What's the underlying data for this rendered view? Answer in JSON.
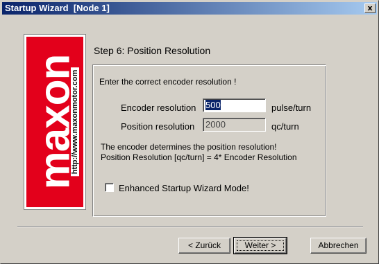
{
  "window": {
    "title": "Startup Wizard  [Node 1]",
    "close_label": "x"
  },
  "logo": {
    "brand": "maxon",
    "url": "http://www.maxonmotor.com"
  },
  "step": {
    "title": "Step 6: Position Resolution"
  },
  "group": {
    "instruction": "Enter the correct encoder resolution !",
    "encoder_label": "Encoder resolution",
    "encoder_value": "500",
    "encoder_unit": "pulse/turn",
    "position_label": "Position resolution",
    "position_value": "2000",
    "position_unit": "qc/turn",
    "note_line1": "The encoder determines the position resolution!",
    "note_line2": "Position Resolution [qc/turn] = 4* Encoder Resolution",
    "checkbox_label": "Enhanced Startup Wizard Mode!",
    "checkbox_checked": false
  },
  "buttons": {
    "back": "< Zurück",
    "next": "Weiter >",
    "cancel": "Abbrechen"
  },
  "colors": {
    "title_gradient_start": "#0a246a",
    "title_gradient_end": "#a6caf0",
    "logo_red": "#e3001b",
    "dialog_face": "#d4d0c8"
  }
}
